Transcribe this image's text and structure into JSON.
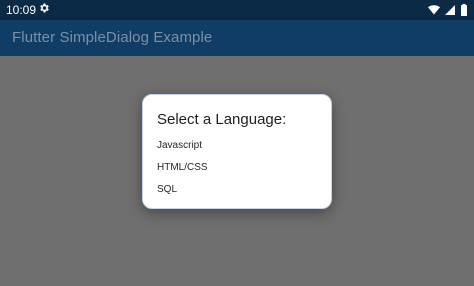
{
  "status_bar": {
    "time": "10:09",
    "icons": [
      "gear-icon",
      "wifi-icon",
      "signal-icon",
      "battery-icon"
    ]
  },
  "app_bar": {
    "title": "Flutter SimpleDialog Example"
  },
  "dialog": {
    "title": "Select a Language:",
    "options": [
      "Javascript",
      "HTML/CSS",
      "SQL"
    ]
  },
  "colors": {
    "status_bar": "#0b2a46",
    "app_bar": "#0f3d66",
    "scrim": "#6f6f6f",
    "dialog_border": "#c6d6ea"
  }
}
